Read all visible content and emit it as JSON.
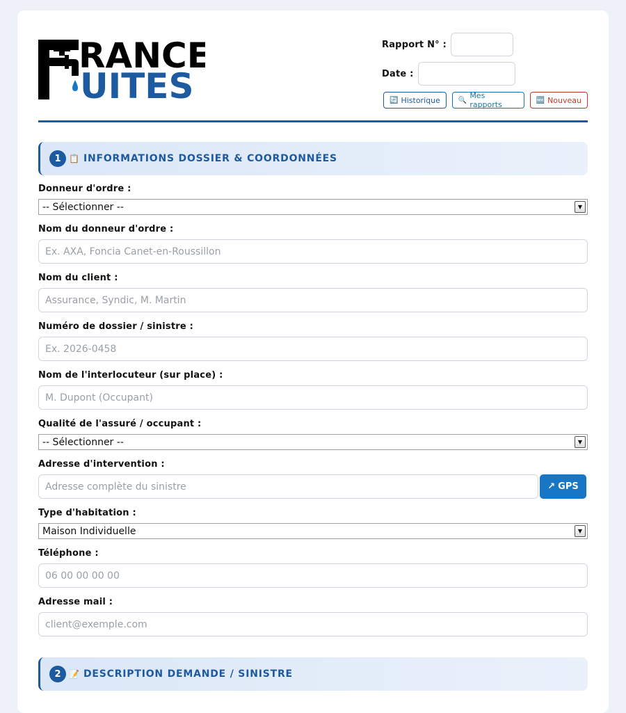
{
  "logo": {
    "line1": "RANCE",
    "line2": "UITES",
    "colors": {
      "black": "#000000",
      "blue": "#1d5aa0",
      "drop": "#1877c5"
    }
  },
  "header": {
    "rapport_label": "Rapport N° :",
    "date_label": "Date :",
    "buttons": [
      {
        "icon": "🔄",
        "label": "Historique"
      },
      {
        "icon": "🔍",
        "label": "Mes rapports"
      },
      {
        "icon": "🆕",
        "label": "Nouveau"
      }
    ]
  },
  "sections": [
    {
      "num": "1",
      "icon": "📋",
      "title": "INFORMATIONS DOSSIER & COORDONNÉES"
    },
    {
      "num": "2",
      "icon": "📝",
      "title": "DESCRIPTION DEMANDE / SINISTRE"
    }
  ],
  "fields": {
    "donneur": {
      "label": "Donneur d'ordre :",
      "value": "-- Sélectionner --"
    },
    "nom_donneur": {
      "label": "Nom du donneur d'ordre :",
      "placeholder": "Ex. AXA, Foncia Canet-en-Roussillon"
    },
    "nom_client": {
      "label": "Nom du client :",
      "placeholder": "Assurance, Syndic, M. Martin"
    },
    "dossier": {
      "label": "Numéro de dossier / sinistre :",
      "placeholder": "Ex. 2026-0458"
    },
    "interlocuteur": {
      "label": "Nom de l'interlocuteur (sur place) :",
      "placeholder": "M. Dupont (Occupant)"
    },
    "qualite": {
      "label": "Qualité de l'assuré / occupant :",
      "value": "-- Sélectionner --"
    },
    "adresse": {
      "label": "Adresse d'intervention :",
      "placeholder": "Adresse complète du sinistre",
      "gps_label": "GPS",
      "gps_icon": "↗"
    },
    "habitation": {
      "label": "Type d'habitation :",
      "value": "Maison Individuelle"
    },
    "telephone": {
      "label": "Téléphone :",
      "placeholder": "06 00 00 00 00"
    },
    "mail": {
      "label": "Adresse mail :",
      "placeholder": "client@exemple.com"
    }
  },
  "colors": {
    "accent": "#1d5aa0",
    "gps": "#1877c5",
    "danger": "#c0392b",
    "background": "#eef2f8"
  }
}
